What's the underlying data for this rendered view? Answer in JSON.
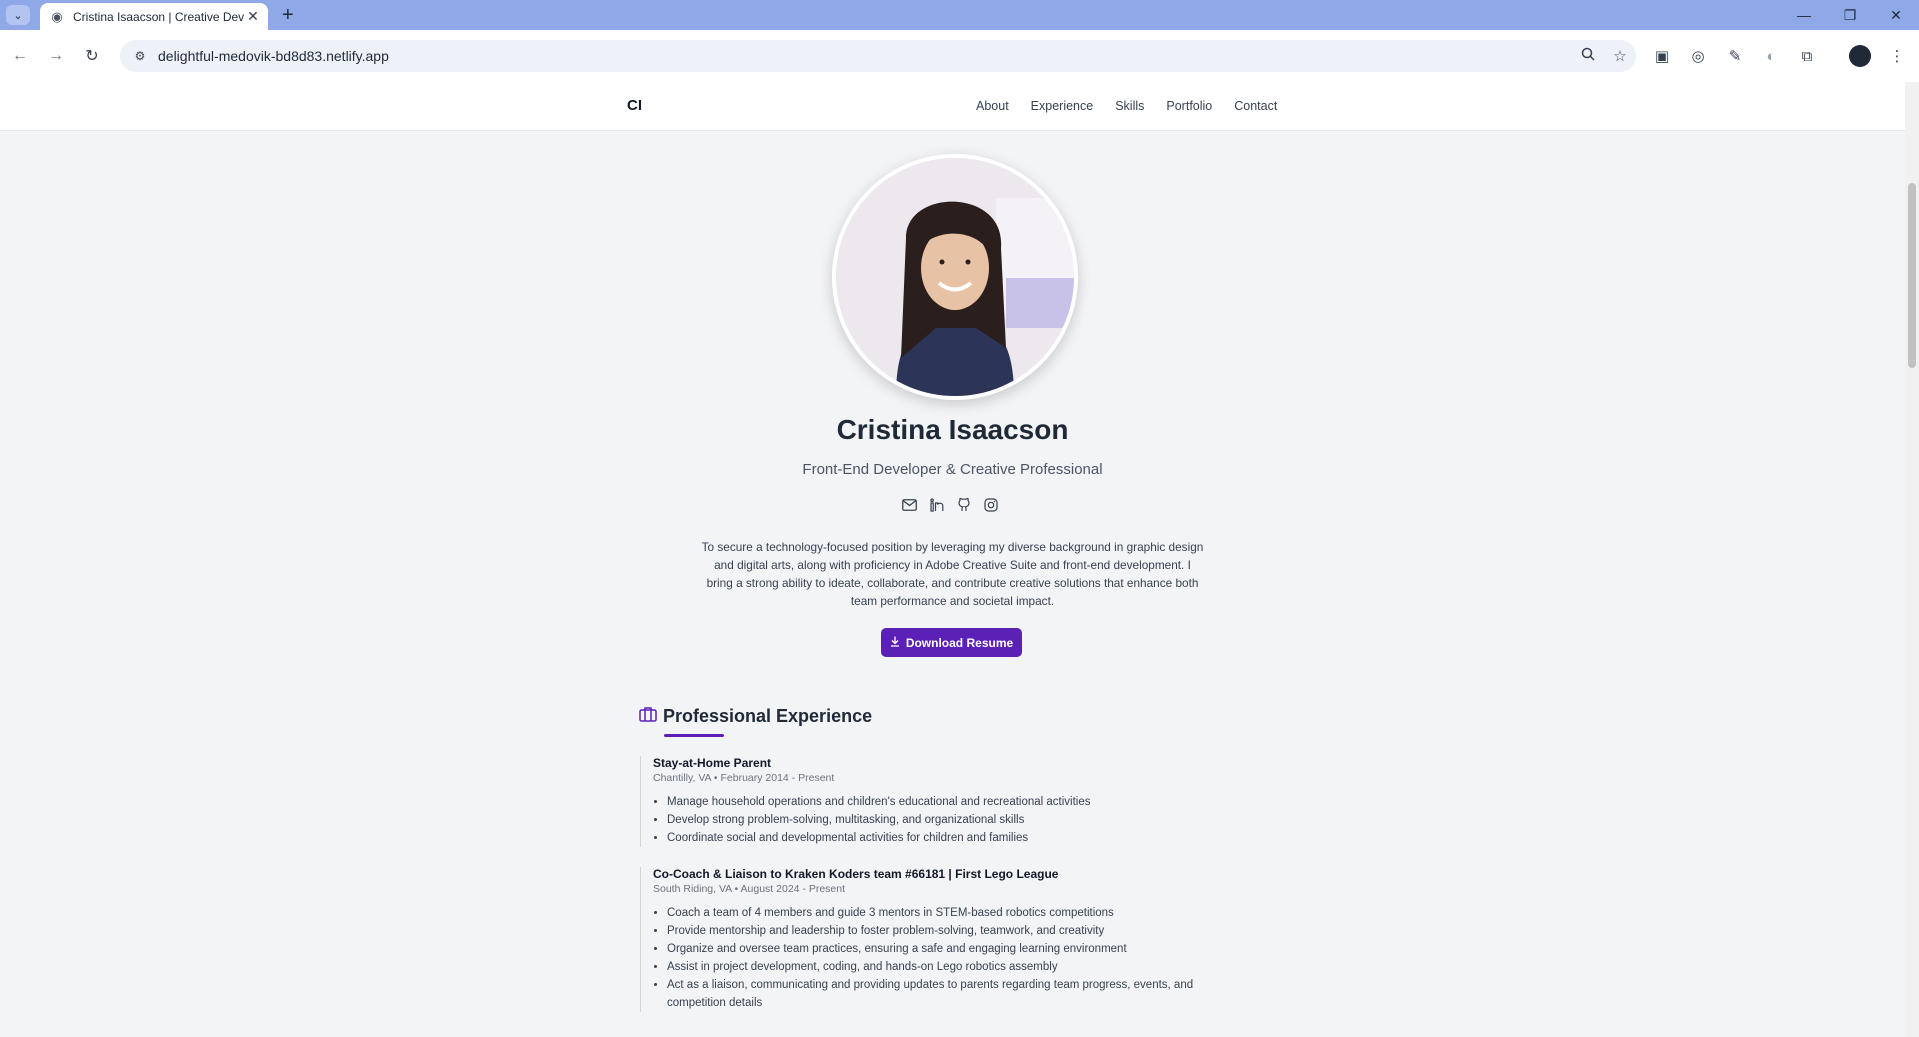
{
  "browser": {
    "tab_title": "Cristina Isaacson | Creative Dev",
    "tab_close": "✕",
    "new_tab": "+",
    "url": "delightful-medovik-bd8d83.netlify.app",
    "window_controls": {
      "minimize": "—",
      "restore": "❐",
      "close": "✕"
    }
  },
  "site": {
    "logo": "CI",
    "nav": [
      "About",
      "Experience",
      "Skills",
      "Portfolio",
      "Contact"
    ]
  },
  "hero": {
    "name": "Cristina Isaacson",
    "subtitle": "Front-End Developer & Creative Professional",
    "social_icons": [
      "mail-icon",
      "linkedin-icon",
      "github-icon",
      "instagram-icon"
    ],
    "summary": "To secure a technology-focused position by leveraging my diverse background in graphic design and digital arts, along with proficiency in Adobe Creative Suite and front-end development. I bring a strong ability to ideate, collaborate, and contribute creative solutions that enhance both team performance and societal impact.",
    "download_label": "Download Resume"
  },
  "experience": {
    "title": "Professional Experience",
    "jobs": [
      {
        "title": "Stay-at-Home Parent",
        "meta": "Chantilly, VA • February 2014 - Present",
        "bullets": [
          "Manage household operations and children's educational and recreational activities",
          "Develop strong problem-solving, multitasking, and organizational skills",
          "Coordinate social and developmental activities for children and families"
        ]
      },
      {
        "title": "Co-Coach & Liaison to Kraken Koders team #66181 | First Lego League",
        "meta": "South Riding, VA • August 2024 - Present",
        "bullets": [
          "Coach a team of 4 members and guide 3 mentors in STEM-based robotics competitions",
          "Provide mentorship and leadership to foster problem-solving, teamwork, and creativity",
          "Organize and oversee team practices, ensuring a safe and engaging learning environment",
          "Assist in project development, coding, and hands-on Lego robotics assembly",
          "Act as a liaison, communicating and providing updates to parents regarding team progress, events, and competition details"
        ]
      }
    ]
  },
  "colors": {
    "accent": "#5b21b6",
    "tabbar": "#8fa8e8"
  }
}
